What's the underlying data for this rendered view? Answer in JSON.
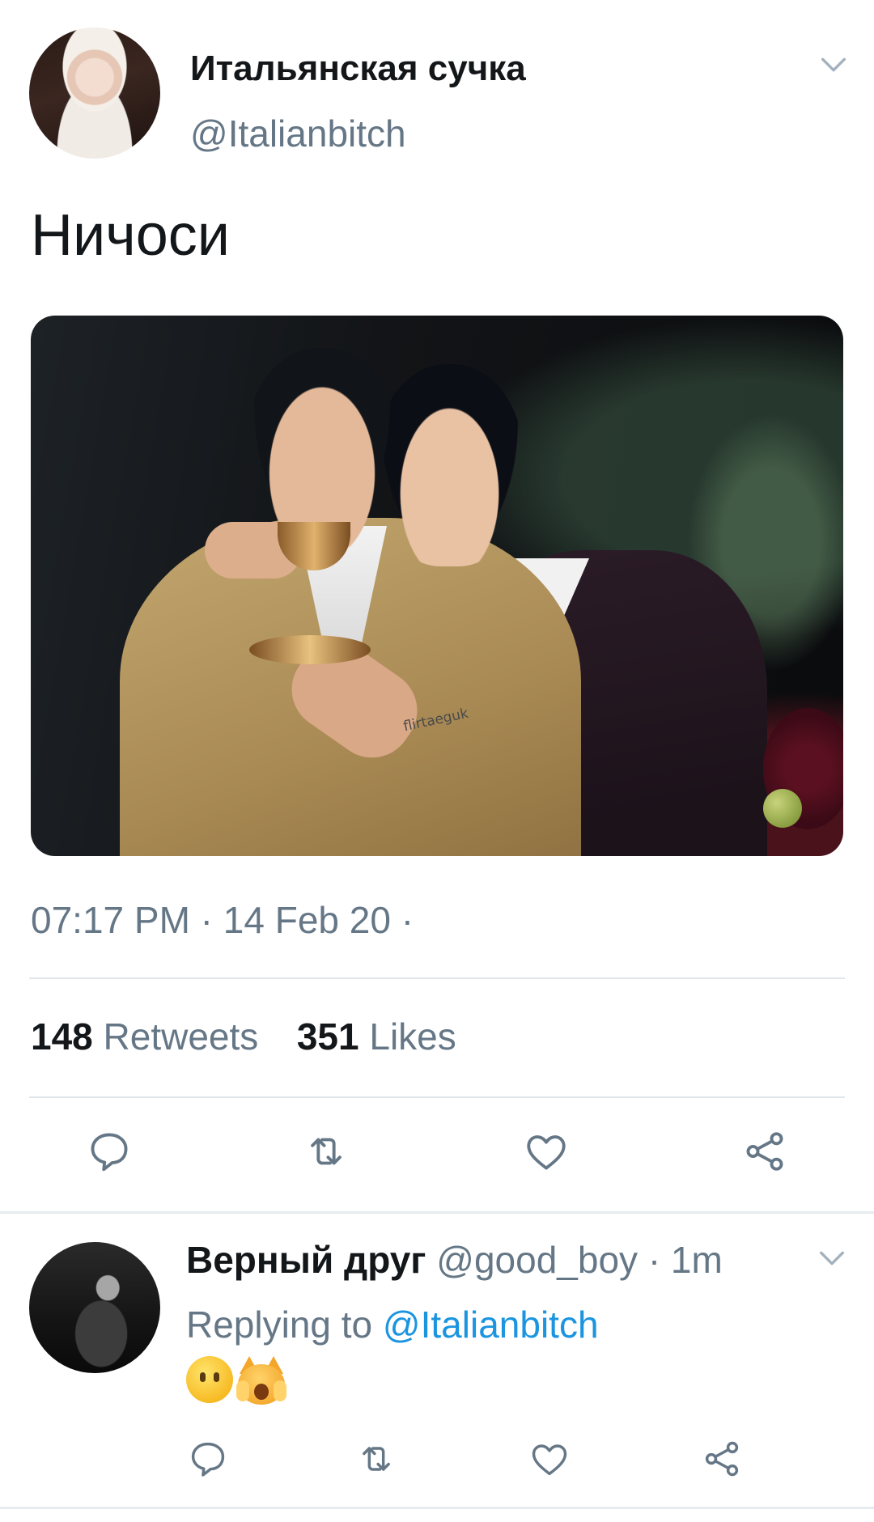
{
  "tweet": {
    "author_name": "Итальянская сучка",
    "author_handle": "@Italianbitch",
    "text": "Ничоси",
    "image_watermark": "flirtaeguk",
    "timestamp": "07:17 PM · 14 Feb 20 ·",
    "retweets_count": "148",
    "retweets_label": "Retweets",
    "likes_count": "351",
    "likes_label": "Likes"
  },
  "reply": {
    "author_name": "Верный друг",
    "author_handle": "@good_boy",
    "time_separator": "·",
    "time": "1m",
    "replying_prefix": "Replying to",
    "replying_mention": "@Italianbitch",
    "emojis": [
      "hushed-face-emoji",
      "weary-cat-emoji"
    ]
  },
  "icons": {
    "chevron": "chevron-down-icon",
    "reply": "reply-icon",
    "retweet": "retweet-icon",
    "like": "heart-icon",
    "share": "share-icon"
  },
  "colors": {
    "text_primary": "#14171a",
    "text_secondary": "#657786",
    "link": "#1b95e0",
    "divider": "#e1e8ed"
  }
}
